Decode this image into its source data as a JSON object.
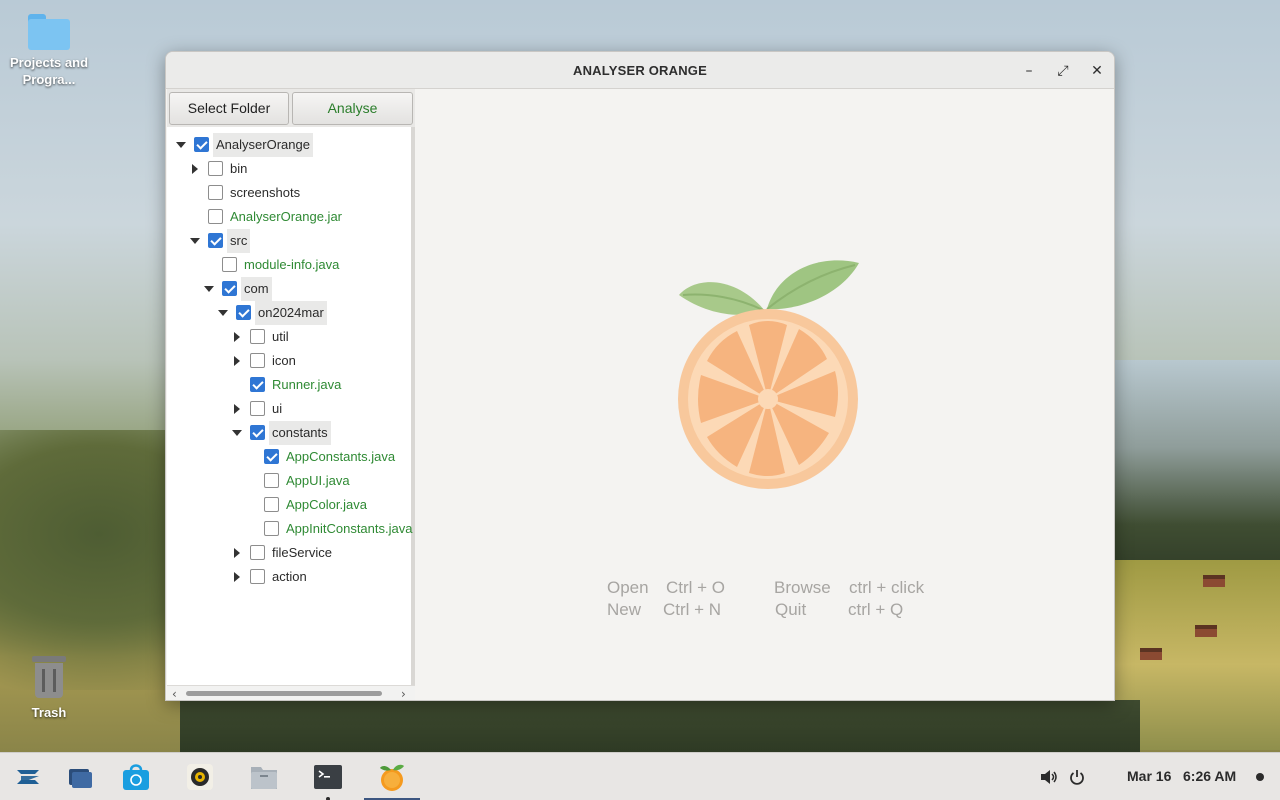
{
  "desktop": {
    "icons": [
      {
        "label": "Projects and Progra...",
        "icon": "folder-icon"
      },
      {
        "label": "Trash",
        "icon": "trash-icon"
      }
    ]
  },
  "window": {
    "title": "ANALYSER ORANGE",
    "controls": {
      "minimize": "–",
      "maximize": "⤢",
      "close": "✕"
    },
    "toolbar": {
      "select_folder": "Select Folder",
      "analyse": "Analyse"
    },
    "tree": [
      {
        "label": "AnalyserOrange",
        "expanded": true,
        "checked": true,
        "kind": "folder"
      },
      {
        "label": "bin",
        "expanded": false,
        "checked": false,
        "kind": "folder"
      },
      {
        "label": "screenshots",
        "expanded": null,
        "checked": false,
        "kind": "folder"
      },
      {
        "label": "AnalyserOrange.jar",
        "expanded": null,
        "checked": false,
        "kind": "file"
      },
      {
        "label": "src",
        "expanded": true,
        "checked": true,
        "kind": "folder"
      },
      {
        "label": "module-info.java",
        "expanded": null,
        "checked": false,
        "kind": "file"
      },
      {
        "label": "com",
        "expanded": true,
        "checked": true,
        "kind": "folder"
      },
      {
        "label": "on2024mar",
        "expanded": true,
        "checked": true,
        "kind": "folder"
      },
      {
        "label": "util",
        "expanded": false,
        "checked": false,
        "kind": "folder"
      },
      {
        "label": "icon",
        "expanded": false,
        "checked": false,
        "kind": "folder"
      },
      {
        "label": "Runner.java",
        "expanded": null,
        "checked": true,
        "kind": "file"
      },
      {
        "label": "ui",
        "expanded": false,
        "checked": false,
        "kind": "folder"
      },
      {
        "label": "constants",
        "expanded": true,
        "checked": true,
        "kind": "folder"
      },
      {
        "label": "AppConstants.java",
        "expanded": null,
        "checked": true,
        "kind": "file"
      },
      {
        "label": "AppUI.java",
        "expanded": null,
        "checked": false,
        "kind": "file"
      },
      {
        "label": "AppColor.java",
        "expanded": null,
        "checked": false,
        "kind": "file"
      },
      {
        "label": "AppInitConstants.java",
        "expanded": null,
        "checked": false,
        "kind": "file"
      },
      {
        "label": "fileService",
        "expanded": false,
        "checked": false,
        "kind": "folder"
      },
      {
        "label": "action",
        "expanded": false,
        "checked": false,
        "kind": "folder"
      }
    ],
    "shortcuts": {
      "open": "Open",
      "open_keys": "Ctrl + O",
      "new": "New",
      "new_keys": "Ctrl + N",
      "browse": "Browse",
      "browse_keys": "ctrl + click",
      "quit": "Quit",
      "quit_keys": "ctrl + Q"
    }
  },
  "taskbar": {
    "apps": [
      "zorin-menu-icon",
      "workspaces-icon",
      "software-store-icon",
      "rhythmbox-icon",
      "files-icon",
      "terminal-icon",
      "analyser-orange-icon"
    ],
    "tray": {
      "date": "Mar 16",
      "time": "6:26 AM"
    }
  },
  "colors": {
    "accent": "#2f76d4",
    "file_text": "#2f8a34",
    "analyse_text": "#2a7d2a",
    "hint_text": "#a7a5a2"
  }
}
